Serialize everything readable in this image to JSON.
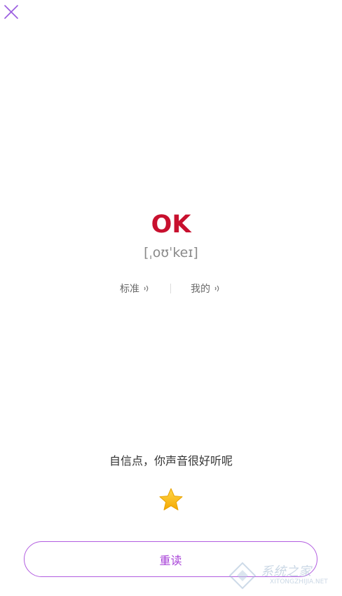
{
  "header": {
    "close_icon": "close-icon"
  },
  "word": {
    "text": "OK",
    "phonetic": "[ˌoʊˈkeɪ]",
    "color": "#c8102e"
  },
  "audio": {
    "standard_label": "标准",
    "mine_label": "我的",
    "icon": "speaker-wave-icon"
  },
  "feedback": {
    "text": "自信点，你声音很好听呢",
    "stars": 1
  },
  "actions": {
    "reread_label": "重读",
    "accent": "#a844d8"
  },
  "watermark": {
    "text": "系统之家",
    "url": "XITONGZHIJIA.NET"
  }
}
